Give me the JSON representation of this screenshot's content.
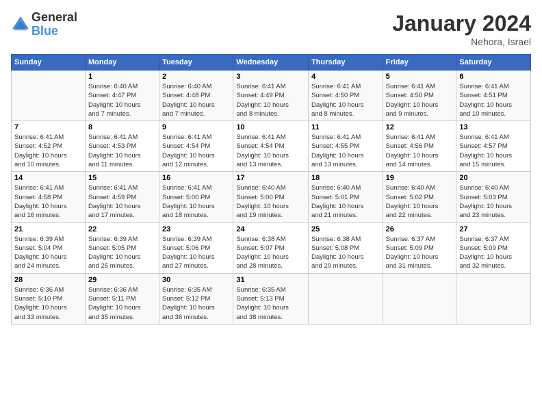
{
  "logo": {
    "general": "General",
    "blue": "Blue"
  },
  "title": "January 2024",
  "subtitle": "Nehora, Israel",
  "days_header": [
    "Sunday",
    "Monday",
    "Tuesday",
    "Wednesday",
    "Thursday",
    "Friday",
    "Saturday"
  ],
  "weeks": [
    [
      {
        "num": "",
        "info": ""
      },
      {
        "num": "1",
        "info": "Sunrise: 6:40 AM\nSunset: 4:47 PM\nDaylight: 10 hours\nand 7 minutes."
      },
      {
        "num": "2",
        "info": "Sunrise: 6:40 AM\nSunset: 4:48 PM\nDaylight: 10 hours\nand 7 minutes."
      },
      {
        "num": "3",
        "info": "Sunrise: 6:41 AM\nSunset: 4:49 PM\nDaylight: 10 hours\nand 8 minutes."
      },
      {
        "num": "4",
        "info": "Sunrise: 6:41 AM\nSunset: 4:50 PM\nDaylight: 10 hours\nand 8 minutes."
      },
      {
        "num": "5",
        "info": "Sunrise: 6:41 AM\nSunset: 4:50 PM\nDaylight: 10 hours\nand 9 minutes."
      },
      {
        "num": "6",
        "info": "Sunrise: 6:41 AM\nSunset: 4:51 PM\nDaylight: 10 hours\nand 10 minutes."
      }
    ],
    [
      {
        "num": "7",
        "info": "Sunrise: 6:41 AM\nSunset: 4:52 PM\nDaylight: 10 hours\nand 10 minutes."
      },
      {
        "num": "8",
        "info": "Sunrise: 6:41 AM\nSunset: 4:53 PM\nDaylight: 10 hours\nand 11 minutes."
      },
      {
        "num": "9",
        "info": "Sunrise: 6:41 AM\nSunset: 4:54 PM\nDaylight: 10 hours\nand 12 minutes."
      },
      {
        "num": "10",
        "info": "Sunrise: 6:41 AM\nSunset: 4:54 PM\nDaylight: 10 hours\nand 13 minutes."
      },
      {
        "num": "11",
        "info": "Sunrise: 6:41 AM\nSunset: 4:55 PM\nDaylight: 10 hours\nand 13 minutes."
      },
      {
        "num": "12",
        "info": "Sunrise: 6:41 AM\nSunset: 4:56 PM\nDaylight: 10 hours\nand 14 minutes."
      },
      {
        "num": "13",
        "info": "Sunrise: 6:41 AM\nSunset: 4:57 PM\nDaylight: 10 hours\nand 15 minutes."
      }
    ],
    [
      {
        "num": "14",
        "info": "Sunrise: 6:41 AM\nSunset: 4:58 PM\nDaylight: 10 hours\nand 16 minutes."
      },
      {
        "num": "15",
        "info": "Sunrise: 6:41 AM\nSunset: 4:59 PM\nDaylight: 10 hours\nand 17 minutes."
      },
      {
        "num": "16",
        "info": "Sunrise: 6:41 AM\nSunset: 5:00 PM\nDaylight: 10 hours\nand 18 minutes."
      },
      {
        "num": "17",
        "info": "Sunrise: 6:40 AM\nSunset: 5:00 PM\nDaylight: 10 hours\nand 19 minutes."
      },
      {
        "num": "18",
        "info": "Sunrise: 6:40 AM\nSunset: 5:01 PM\nDaylight: 10 hours\nand 21 minutes."
      },
      {
        "num": "19",
        "info": "Sunrise: 6:40 AM\nSunset: 5:02 PM\nDaylight: 10 hours\nand 22 minutes."
      },
      {
        "num": "20",
        "info": "Sunrise: 6:40 AM\nSunset: 5:03 PM\nDaylight: 10 hours\nand 23 minutes."
      }
    ],
    [
      {
        "num": "21",
        "info": "Sunrise: 6:39 AM\nSunset: 5:04 PM\nDaylight: 10 hours\nand 24 minutes."
      },
      {
        "num": "22",
        "info": "Sunrise: 6:39 AM\nSunset: 5:05 PM\nDaylight: 10 hours\nand 25 minutes."
      },
      {
        "num": "23",
        "info": "Sunrise: 6:39 AM\nSunset: 5:06 PM\nDaylight: 10 hours\nand 27 minutes."
      },
      {
        "num": "24",
        "info": "Sunrise: 6:38 AM\nSunset: 5:07 PM\nDaylight: 10 hours\nand 28 minutes."
      },
      {
        "num": "25",
        "info": "Sunrise: 6:38 AM\nSunset: 5:08 PM\nDaylight: 10 hours\nand 29 minutes."
      },
      {
        "num": "26",
        "info": "Sunrise: 6:37 AM\nSunset: 5:09 PM\nDaylight: 10 hours\nand 31 minutes."
      },
      {
        "num": "27",
        "info": "Sunrise: 6:37 AM\nSunset: 5:09 PM\nDaylight: 10 hours\nand 32 minutes."
      }
    ],
    [
      {
        "num": "28",
        "info": "Sunrise: 6:36 AM\nSunset: 5:10 PM\nDaylight: 10 hours\nand 33 minutes."
      },
      {
        "num": "29",
        "info": "Sunrise: 6:36 AM\nSunset: 5:11 PM\nDaylight: 10 hours\nand 35 minutes."
      },
      {
        "num": "30",
        "info": "Sunrise: 6:35 AM\nSunset: 5:12 PM\nDaylight: 10 hours\nand 36 minutes."
      },
      {
        "num": "31",
        "info": "Sunrise: 6:35 AM\nSunset: 5:13 PM\nDaylight: 10 hours\nand 38 minutes."
      },
      {
        "num": "",
        "info": ""
      },
      {
        "num": "",
        "info": ""
      },
      {
        "num": "",
        "info": ""
      }
    ]
  ]
}
